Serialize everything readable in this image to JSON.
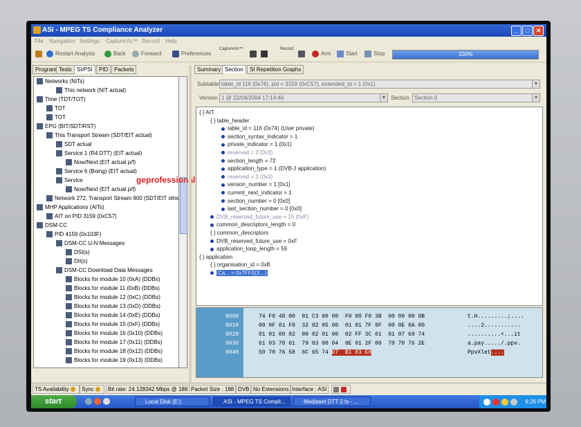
{
  "window": {
    "title": "ASI - MPEG TS Compliance Analyzer"
  },
  "menu": [
    "File",
    "Navigation",
    "Settings",
    "CaptureVu™",
    "Record",
    "Help"
  ],
  "toolbar": {
    "restart": "Restart Analysis",
    "back": "Back",
    "forward": "Forward",
    "preferences": "Preferences",
    "capture_group": "CaptureVu™",
    "record_group": "Record",
    "arm": "Arm",
    "start": "Start",
    "stop": "Stop",
    "progress_label": "100%",
    "progress_value": 1.0
  },
  "left_tabs": [
    "Program",
    "Tests",
    "SI/PSI",
    "PID",
    "Packets"
  ],
  "left_active_tab": "SI/PSI",
  "tree": [
    {
      "label": "Networks (NITs)",
      "indent": 0
    },
    {
      "label": "This network (NIT actual)",
      "indent": 2
    },
    {
      "label": "Time (TDT/TOT)",
      "indent": 0
    },
    {
      "label": "TDT",
      "indent": 1
    },
    {
      "label": "TOT",
      "indent": 1
    },
    {
      "label": "EPG (BIT/SDT/RST)",
      "indent": 0
    },
    {
      "label": "This Transport Stream (SDT/EIT actual)",
      "indent": 1
    },
    {
      "label": "SDT actual",
      "indent": 2
    },
    {
      "label": "Service 1 (R4 DTT) (EIT actual)",
      "indent": 2
    },
    {
      "label": "Now/Next (EIT actual p/f)",
      "indent": 3
    },
    {
      "label": "Service 6 (Boing) (EIT actual)",
      "indent": 2
    },
    {
      "label": "Service",
      "indent": 2
    },
    {
      "label": "Now/Next (EIT actual p/f)",
      "indent": 3
    },
    {
      "label": "Network 272, Transport Stream 900 (SDT/EIT othe",
      "indent": 1
    },
    {
      "label": "MHP Applications (AITs)",
      "indent": 0
    },
    {
      "label": "AIT on PID 3159 (0xC57)",
      "indent": 1
    },
    {
      "label": "DSM-CC",
      "indent": 0
    },
    {
      "label": "PID 4159 (0x103F)",
      "indent": 1
    },
    {
      "label": "DSM-CC U-N Messages",
      "indent": 2
    },
    {
      "label": "DSI(s)",
      "indent": 3
    },
    {
      "label": "DII(s)",
      "indent": 3
    },
    {
      "label": "DSM-CC Download Data Messages",
      "indent": 2
    },
    {
      "label": "Blocks for module 10 (0xA) (DDBs)",
      "indent": 3
    },
    {
      "label": "Blocks for module 11 (0xB) (DDBs)",
      "indent": 3
    },
    {
      "label": "Blocks for module 12 (0xC) (DDBs)",
      "indent": 3
    },
    {
      "label": "Blocks for module 13 (0xD) (DDBs)",
      "indent": 3
    },
    {
      "label": "Blocks for module 14 (0xE) (DDBs)",
      "indent": 3
    },
    {
      "label": "Blocks for module 15 (0xF) (DDBs)",
      "indent": 3
    },
    {
      "label": "Blocks for module 16 (0x10) (DDBs)",
      "indent": 3
    },
    {
      "label": "Blocks for module 17 (0x11) (DDBs)",
      "indent": 3
    },
    {
      "label": "Blocks for module 18 (0x12) (DDBs)",
      "indent": 3
    },
    {
      "label": "Blocks for module 19 (0x13) (DDBs)",
      "indent": 3
    }
  ],
  "watermark": "geprofessional.com",
  "right_tabs": [
    "Summary",
    "Section",
    "SI Repetition Graphs"
  ],
  "right_active_tab": "Section",
  "subtable": {
    "label": "Subtable",
    "value": "table_id 116 (0x74), pid = 3159 (0xC57), extended_id = 1 (0x1)"
  },
  "version": {
    "label": "Version",
    "value": "1 @ 22/04/2004 17:14:46"
  },
  "section": {
    "label": "Section",
    "value": "Section 0"
  },
  "detail_rows": [
    {
      "text": "AIT",
      "indent": 0,
      "kind": "braces",
      "style": "normal"
    },
    {
      "text": "table_header",
      "indent": 1,
      "kind": "braces",
      "style": "normal"
    },
    {
      "text": "table_id = 116 (0x74) (User private)",
      "indent": 2,
      "kind": "bullet",
      "style": "normal"
    },
    {
      "text": "section_syntax_indicator = 1",
      "indent": 2,
      "kind": "bullet",
      "style": "normal"
    },
    {
      "text": "private_indicator = 1 (0x1)",
      "indent": 2,
      "kind": "bullet",
      "style": "normal"
    },
    {
      "text": "reserved = 3 (0x3)",
      "indent": 2,
      "kind": "bullet",
      "style": "grey"
    },
    {
      "text": "section_length = 72",
      "indent": 2,
      "kind": "bullet",
      "style": "normal"
    },
    {
      "text": "application_type = 1 (DVB-J application)",
      "indent": 2,
      "kind": "bullet",
      "style": "normal"
    },
    {
      "text": "reserved = 3 (0x3)",
      "indent": 2,
      "kind": "bullet",
      "style": "grey"
    },
    {
      "text": "version_number = 1 [0x1]",
      "indent": 2,
      "kind": "bullet",
      "style": "normal"
    },
    {
      "text": "current_next_indicator = 1",
      "indent": 2,
      "kind": "bullet",
      "style": "normal"
    },
    {
      "text": "section_number = 0 [0x0]",
      "indent": 2,
      "kind": "bullet",
      "style": "normal"
    },
    {
      "text": "last_section_number = 0 [0x0]",
      "indent": 2,
      "kind": "bullet",
      "style": "normal"
    },
    {
      "text": "DVB_reserved_future_use = 15 (0xF)",
      "indent": 1,
      "kind": "bullet",
      "style": "grey"
    },
    {
      "text": "common_descriptors_length = 0",
      "indent": 1,
      "kind": "bullet",
      "style": "normal"
    },
    {
      "text": "common_descriptors",
      "indent": 1,
      "kind": "braces",
      "style": "normal"
    },
    {
      "text": "DVB_reserved_future_use = 0xF",
      "indent": 1,
      "kind": "bullet",
      "style": "normal"
    },
    {
      "text": "application_loop_length = 59",
      "indent": 1,
      "kind": "bullet",
      "style": "normal"
    },
    {
      "text": "application",
      "indent": 0,
      "kind": "braces",
      "style": "normal"
    },
    {
      "text": "organisation_id = 0xB",
      "indent": 1,
      "kind": "braces",
      "style": "normal"
    },
    {
      "text": "Ca... = 0x7FF0(X...)",
      "indent": 1,
      "kind": "bullet",
      "style": "selected"
    }
  ],
  "hex": {
    "offsets": [
      "0000",
      "0010",
      "0020",
      "0030",
      "0040"
    ],
    "bytes": [
      "74 F0 48 00  01 C3 00 00  F0 00 F0 3B  00 00 00 0B",
      "00 9F 01 F0  32 02 05 00  01 01 7F 9F  00 0E 0A 00",
      "01 01 00 02  00 02 01 00  02 FF 3C 01  01 07 69 74",
      "61 03 70 61  79 03 00 04  0E 01 2F 00  70 70 76 2E",
      "50 70 76 58  6C 65 74"
    ],
    "bytes_highlight": [
      "",
      "",
      "",
      "",
      "D7  B1 83 E8"
    ],
    "ascii": [
      "t.H.........;....",
      "....2...........",
      "..........<...it",
      "a.pay...../.ppv.",
      "PpvXlet"
    ],
    "ascii_highlight": [
      "",
      "",
      "",
      "",
      "...."
    ]
  },
  "status": {
    "ts_availability": "TS Availability",
    "sync": "Sync",
    "bitrate": "Bit rate: 24.128342 Mbps @ 188",
    "packet_size": "Packet Size : 188",
    "dvb": "DVB",
    "extensions": "No Extensions",
    "interface": "Interface : ASI"
  },
  "taskbar": {
    "start": "start",
    "tasks": [
      "Local Disk (E:)",
      "ASI - MPEG TS Compli...",
      "Mediaset DTT 2.ts - ..."
    ],
    "clock": "6:26 PM"
  },
  "colors": {
    "title_bar": "#1d47b5",
    "selection": "#3d6fd0",
    "hex_highlight": "#b5321e",
    "taskbar": "#2556c6"
  }
}
